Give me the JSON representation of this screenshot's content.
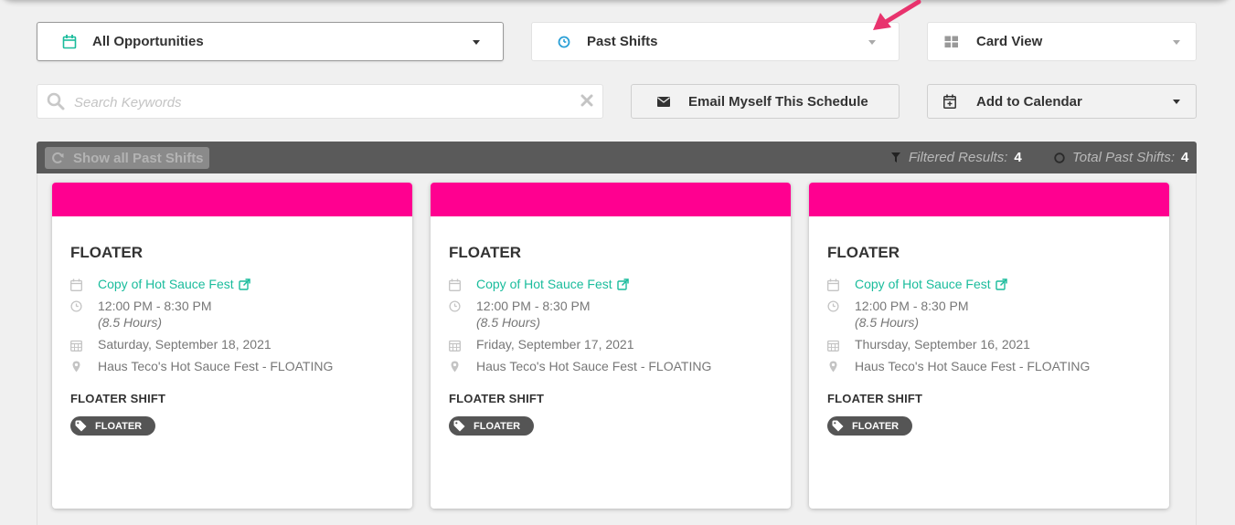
{
  "filters": {
    "opportunities": {
      "label": "All Opportunities",
      "icon": "calendar-icon"
    },
    "timeframe": {
      "label": "Past Shifts",
      "icon": "clock-icon"
    },
    "view": {
      "label": "Card View",
      "icon": "grid-icon"
    }
  },
  "search": {
    "placeholder": "Search Keywords",
    "value": ""
  },
  "actions": {
    "email_label": "Email Myself This Schedule",
    "calendar_label": "Add to Calendar"
  },
  "results": {
    "show_all_label": "Show all Past Shifts",
    "filtered_label": "Filtered Results:",
    "filtered_count": "4",
    "total_label": "Total Past Shifts:",
    "total_count": "4"
  },
  "colors": {
    "accent": "#ff0090",
    "link": "#1abc9c",
    "bar": "#5a5a5a",
    "clock_icon": "#2a9fd6",
    "calendar_icon": "#1abc9c",
    "annotation_arrow": "#e8336d"
  },
  "cards": [
    {
      "title": "FLOATER",
      "event": "Copy of Hot Sauce Fest",
      "time": "12:00 PM - 8:30 PM",
      "duration": "(8.5 Hours)",
      "date": "Saturday, September 18, 2021",
      "location": "Haus Teco's Hot Sauce Fest - FLOATING",
      "shift_label": "FLOATER SHIFT",
      "tag": "FLOATER"
    },
    {
      "title": "FLOATER",
      "event": "Copy of Hot Sauce Fest",
      "time": "12:00 PM - 8:30 PM",
      "duration": "(8.5 Hours)",
      "date": "Friday, September 17, 2021",
      "location": "Haus Teco's Hot Sauce Fest - FLOATING",
      "shift_label": "FLOATER SHIFT",
      "tag": "FLOATER"
    },
    {
      "title": "FLOATER",
      "event": "Copy of Hot Sauce Fest",
      "time": "12:00 PM - 8:30 PM",
      "duration": "(8.5 Hours)",
      "date": "Thursday, September 16, 2021",
      "location": "Haus Teco's Hot Sauce Fest - FLOATING",
      "shift_label": "FLOATER SHIFT",
      "tag": "FLOATER"
    }
  ]
}
